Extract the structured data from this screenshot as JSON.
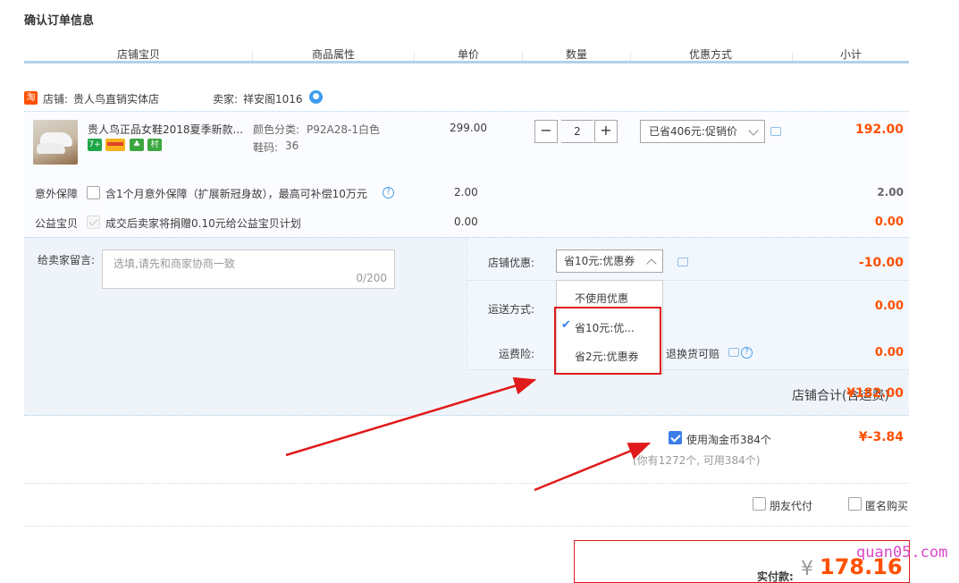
{
  "page_title": "确认订单信息",
  "columns": [
    "店铺宝贝",
    "商品属性",
    "单价",
    "数量",
    "优惠方式",
    "小计"
  ],
  "shop": {
    "badge": "淘",
    "name_label": "店铺:",
    "name": "贵人鸟直销实体店",
    "seller_label": "卖家:",
    "seller": "祥安阁1016"
  },
  "item": {
    "title": "贵人鸟正品女鞋2018夏季新款...",
    "icons": [
      "7+",
      "card",
      "tree",
      "村"
    ],
    "color_label": "颜色分类:",
    "color": "P92A28-1白色",
    "size_label": "鞋码:",
    "size": "36",
    "price": "299.00",
    "quantity": "2",
    "minus": "−",
    "plus": "+",
    "promo": "已省406元:促销价",
    "subtotal": "192.00"
  },
  "services": [
    {
      "label": "意外保障",
      "text": "含1个月意外保障（扩展新冠身故），最高可补偿10万元",
      "price": "2.00",
      "subtotal": "2.00"
    },
    {
      "label": "公益宝贝",
      "text": "成交后卖家将捐赠0.10元给公益宝贝计划",
      "price": "0.00",
      "subtotal": "0.00"
    }
  ],
  "note": {
    "label": "给卖家留言:",
    "placeholder": "选填,请先和商家协商一致",
    "count": "0/200"
  },
  "shop_discount": {
    "label": "店铺优惠:",
    "selected": "省10元:优惠券",
    "amount": "-10.00",
    "options": [
      "不使用优惠",
      "省10元:优...",
      "省2元:优惠券"
    ]
  },
  "shipping": {
    "label": "运送方式:",
    "amount": "0.00"
  },
  "freight_insurance": {
    "label": "运费险:",
    "text": "退换货可赔",
    "amount": "0.00"
  },
  "shop_total": {
    "label": "店铺合计(含运费)",
    "amount": "¥182.00"
  },
  "coins": {
    "label": "使用淘金币384个",
    "sub": "(你有1272个, 可用384个)",
    "amount": "¥-3.84"
  },
  "options": {
    "friend_pay": "朋友代付",
    "anonymous": "匿名购买"
  },
  "payment": {
    "label": "实付款:",
    "yen": "¥",
    "amount": "178.16"
  },
  "watermark": "quan05.com",
  "colors": {
    "accent": "#ff5000",
    "annotation_red": "#e01a1a",
    "link_blue": "#3b7de9"
  }
}
